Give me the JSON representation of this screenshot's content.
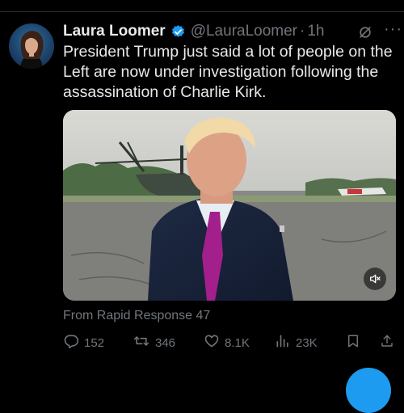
{
  "tweet": {
    "author_name": "Laura Loomer",
    "handle": "@LauraLoomer",
    "separator": "·",
    "time": "1h",
    "text": "President Trump just said a lot of people on the Left are now under investigation following the assassination of Charlie Kirk.",
    "source": "From Rapid Response 47",
    "more_label": "···"
  },
  "actions": {
    "replies": "152",
    "reposts": "346",
    "likes": "8.1K",
    "views": "23K"
  },
  "icons": {
    "verified": "verified-badge-icon",
    "grok": "grok-icon",
    "more": "more-icon",
    "mute": "volume-mute-icon",
    "reply": "reply-icon",
    "repost": "repost-icon",
    "like": "heart-icon",
    "views": "views-icon",
    "bookmark": "bookmark-icon",
    "share": "share-icon"
  },
  "colors": {
    "background": "#000000",
    "text": "#e7e9ea",
    "muted": "#71767b",
    "accent": "#1d9bf0"
  }
}
